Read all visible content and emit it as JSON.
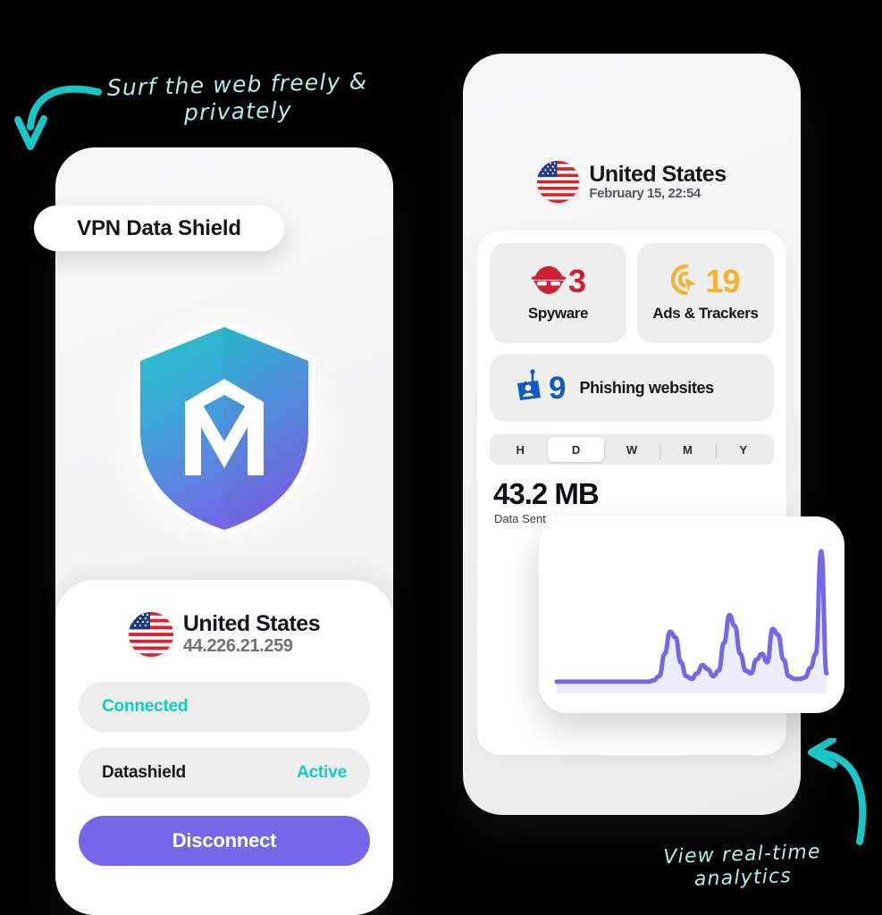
{
  "annotations": {
    "top": "Surf the web freely &\nprivately",
    "bottom": "View real-time\nanalytics",
    "color": "#b4ecec"
  },
  "left_phone": {
    "badge_label": "VPN Data Shield",
    "logo_icon": "shield-logo-icon",
    "shield_gradient": {
      "from": "#27c4c9",
      "to": "#7567e8"
    },
    "connection": {
      "flag_icon": "us-flag-icon",
      "country": "United States",
      "ip_address": "44.226.21.259"
    },
    "status_rows": [
      {
        "label": "Connected",
        "value": "",
        "accent": "#0ed0c0"
      },
      {
        "label": "Datashield",
        "value": "Active",
        "accent": "#0ed0c0"
      }
    ],
    "disconnect_label": "Disconnect",
    "disconnect_color": "#7567e8"
  },
  "right_phone": {
    "header": {
      "flag_icon": "us-flag-icon",
      "country": "United States",
      "timestamp": "February 15, 22:54"
    },
    "stats": [
      {
        "icon": "spy-icon",
        "count": "3",
        "label": "Spyware",
        "color": "#cc2033"
      },
      {
        "icon": "target-cursor-icon",
        "count": "19",
        "label": "Ads & Trackers",
        "color": "#f5b335"
      }
    ],
    "phishing": {
      "icon": "phishing-hook-icon",
      "count": "9",
      "label": "Phishing websites",
      "color": "#1259c3"
    },
    "range_tabs": [
      {
        "key": "H",
        "label": "H",
        "selected": false
      },
      {
        "key": "D",
        "label": "D",
        "selected": true
      },
      {
        "key": "W",
        "label": "W",
        "selected": false
      },
      {
        "key": "M",
        "label": "M",
        "selected": false
      },
      {
        "key": "Y",
        "label": "Y",
        "selected": false
      }
    ],
    "data_sent": {
      "value": "43.2 MB",
      "label": "Data Sent"
    }
  },
  "chart_data": {
    "type": "area",
    "title": "Data Sent",
    "xlabel": "",
    "ylabel": "",
    "grid": false,
    "legend": "none",
    "line_color": "#7567e8",
    "fill_color": "#efecfd",
    "ylim": [
      0,
      100
    ],
    "x": [
      0,
      1,
      2,
      3,
      4,
      5,
      6,
      7,
      8,
      9,
      10,
      11,
      12,
      13,
      14,
      15,
      16,
      17,
      18,
      19,
      20,
      21,
      22,
      23,
      24,
      25,
      26,
      27,
      28,
      29,
      30,
      31,
      32,
      33,
      34,
      35,
      36,
      37,
      38,
      39,
      40,
      41,
      42,
      43,
      44,
      45,
      46,
      47,
      48,
      49,
      50
    ],
    "values": [
      2,
      2,
      2,
      2,
      2,
      2,
      2,
      2,
      2,
      2,
      2,
      2,
      2,
      2,
      2,
      2,
      2,
      2,
      3,
      6,
      22,
      38,
      34,
      16,
      6,
      4,
      8,
      14,
      11,
      6,
      10,
      30,
      50,
      42,
      22,
      10,
      8,
      18,
      22,
      16,
      40,
      36,
      18,
      6,
      4,
      4,
      5,
      12,
      22,
      96,
      8
    ]
  }
}
